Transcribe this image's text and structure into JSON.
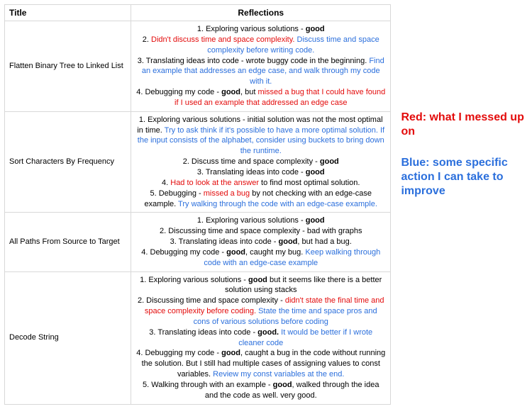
{
  "headers": {
    "title": "Title",
    "reflections": "Reflections"
  },
  "legend": {
    "red": "Red: what I messed up on",
    "blue": "Blue: some specific action I can take to improve"
  },
  "rows": [
    {
      "title": "Flatten Binary Tree to Linked List",
      "lines": [
        [
          {
            "t": "1. Exploring various solutions - ",
            "c": "black"
          },
          {
            "t": "good",
            "c": "black",
            "b": true
          }
        ],
        [
          {
            "t": "2. ",
            "c": "black"
          },
          {
            "t": "Didn't discuss time and space complexity.",
            "c": "red"
          },
          {
            "t": " Discuss time and space complexity before writing code.",
            "c": "blue"
          }
        ],
        [
          {
            "t": "3. Translating ideas into code - wrote buggy code in the beginning. ",
            "c": "black"
          },
          {
            "t": "Find an example that addresses an edge case, and walk through my code with it.",
            "c": "blue"
          }
        ],
        [
          {
            "t": "4. Debugging my code - ",
            "c": "black"
          },
          {
            "t": "good",
            "c": "black",
            "b": true
          },
          {
            "t": ", but ",
            "c": "black"
          },
          {
            "t": "missed a bug that I could have found if I used an example that addressed an edge case",
            "c": "red"
          }
        ]
      ]
    },
    {
      "title": "Sort Characters By Frequency",
      "lines": [
        [
          {
            "t": "1. Exploring various solutions - initial solution was not the most optimal in time. ",
            "c": "black"
          },
          {
            "t": "Try to ask think if it's possible to have a more optimal solution. If the input consists of the alphabet, consider using buckets to bring down the runtime.",
            "c": "blue"
          }
        ],
        [
          {
            "t": "2. Discuss time and space complexity - ",
            "c": "black"
          },
          {
            "t": "good",
            "c": "black",
            "b": true
          }
        ],
        [
          {
            "t": "3. Translating ideas into code - ",
            "c": "black"
          },
          {
            "t": "good",
            "c": "black",
            "b": true
          }
        ],
        [
          {
            "t": "4. ",
            "c": "black"
          },
          {
            "t": "Had to look at the answer",
            "c": "red"
          },
          {
            "t": " to find most optimal solution.",
            "c": "black"
          }
        ],
        [
          {
            "t": "5. Debugging - ",
            "c": "black"
          },
          {
            "t": "missed a bug",
            "c": "red"
          },
          {
            "t": " by not checking with an edge-case example. ",
            "c": "black"
          },
          {
            "t": "Try walking through the code with an edge-case example.",
            "c": "blue"
          }
        ]
      ]
    },
    {
      "title": "All Paths From Source to Target",
      "lines": [
        [
          {
            "t": "1. Exploring various solutions - ",
            "c": "black"
          },
          {
            "t": "good",
            "c": "black",
            "b": true
          }
        ],
        [
          {
            "t": "2. Discussing time and space complexity - bad with graphs",
            "c": "black"
          }
        ],
        [
          {
            "t": "3. Translating ideas into code - ",
            "c": "black"
          },
          {
            "t": "good",
            "c": "black",
            "b": true
          },
          {
            "t": ", but had a bug.",
            "c": "black"
          }
        ],
        [
          {
            "t": "4. Debugging my code - ",
            "c": "black"
          },
          {
            "t": "good",
            "c": "black",
            "b": true
          },
          {
            "t": ", caught my bug. ",
            "c": "black"
          },
          {
            "t": "Keep walking through code with an edge-case example",
            "c": "blue"
          }
        ]
      ]
    },
    {
      "title": "Decode String",
      "lines": [
        [
          {
            "t": "1. Exploring various solutions - ",
            "c": "black"
          },
          {
            "t": "good",
            "c": "black",
            "b": true
          },
          {
            "t": " but it seems like there is a better solution using stacks",
            "c": "black"
          }
        ],
        [
          {
            "t": "2. Discussing time and space complexity - ",
            "c": "black"
          },
          {
            "t": "didn't state the final time and space complexity before coding.",
            "c": "red"
          },
          {
            "t": " State the time and space pros and cons of various solutions before coding",
            "c": "blue"
          }
        ],
        [
          {
            "t": "3. Translating ideas into code - ",
            "c": "black"
          },
          {
            "t": "good.",
            "c": "black",
            "b": true
          },
          {
            "t": " It would be better if I wrote cleaner code",
            "c": "blue"
          }
        ],
        [
          {
            "t": "4. Debugging my code - ",
            "c": "black"
          },
          {
            "t": "good",
            "c": "black",
            "b": true
          },
          {
            "t": ", caught a bug in the code without running the solution. But I still had multiple cases of assigning values to const variables. ",
            "c": "black"
          },
          {
            "t": "Review my const variables at the end.",
            "c": "blue"
          }
        ],
        [
          {
            "t": "5. Walking through with an example - ",
            "c": "black"
          },
          {
            "t": "good",
            "c": "black",
            "b": true
          },
          {
            "t": ", walked through the idea and the code as well. very good.",
            "c": "black"
          }
        ]
      ]
    }
  ]
}
